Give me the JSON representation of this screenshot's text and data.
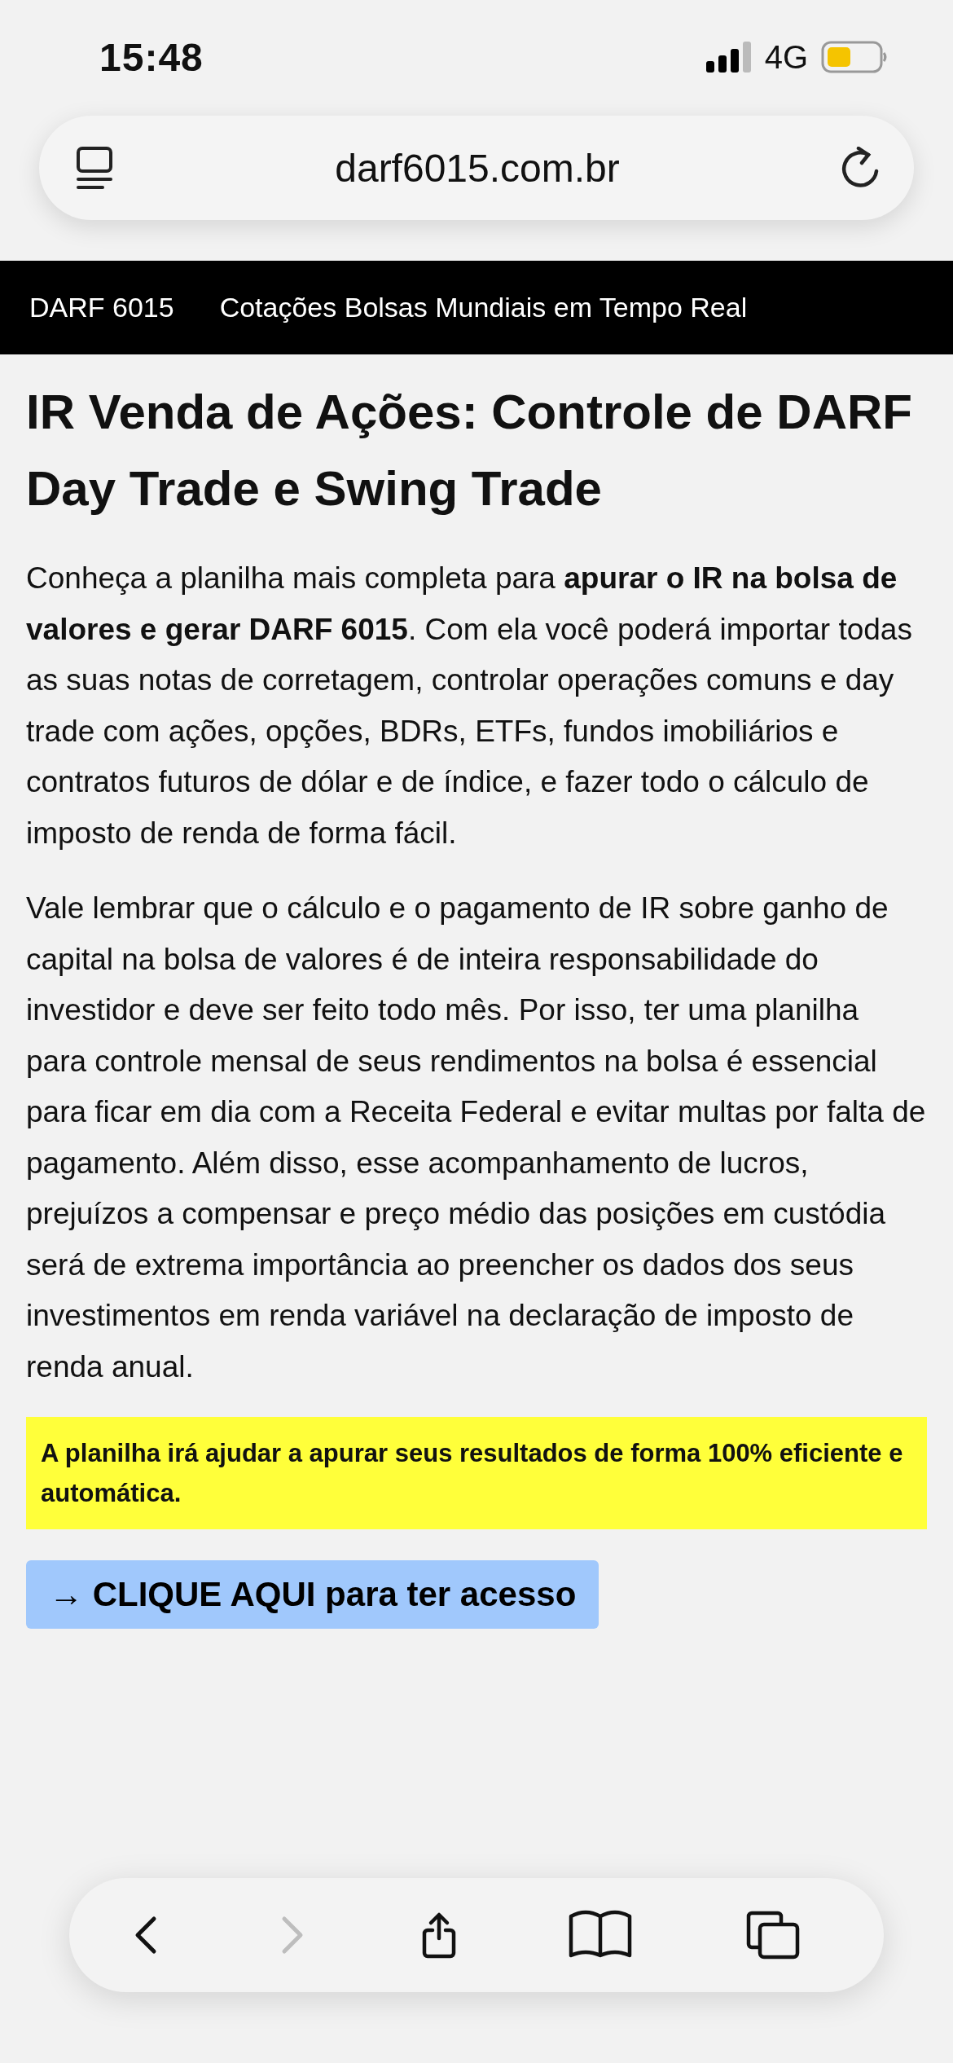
{
  "status_bar": {
    "time": "15:48",
    "network": "4G"
  },
  "address_bar": {
    "url": "darf6015.com.br"
  },
  "site_nav": {
    "items": [
      {
        "label": "DARF 6015"
      },
      {
        "label": "Cotações Bolsas Mundiais em Tempo Real"
      }
    ]
  },
  "article": {
    "title": "IR Venda de Ações: Controle de DARF Day Trade e Swing Trade",
    "paragraphs": [
      "Conheça a planilha mais completa para **apurar o IR na bolsa de valores e gerar DARF 6015**. Com ela você poderá importar todas as suas notas de corretagem, controlar operações comuns e day trade com ações, opções, BDRs, ETFs, fundos imobiliários e contratos futuros de dólar e de índice, e fazer todo o cálculo de imposto de renda de forma fácil.",
      "Vale lembrar que o cálculo e o pagamento de IR sobre ganho de capital na bolsa de valores é de inteira responsabilidade do investidor e deve ser feito todo mês. Por isso, ter uma planilha para controle mensal de seus rendimentos na bolsa é essencial para ficar em dia com a Receita Federal e evitar multas por falta de pagamento. Além disso, esse acompanhamento de lucros, prejuízos a compensar e preço médio das posições em custódia será de extrema importância ao preencher os dados dos seus investimentos em renda variável na declaração de imposto de renda anual."
    ],
    "highlight": "A planilha irá ajudar a apurar seus resultados de forma 100% eficiente e automática.",
    "cta": "→ CLIQUE AQUI para ter acesso"
  },
  "toolbar": {
    "buttons": [
      {
        "kind": "back",
        "disabled": false
      },
      {
        "kind": "forward",
        "disabled": true
      },
      {
        "kind": "share",
        "disabled": false
      },
      {
        "kind": "bookmarks",
        "disabled": false
      },
      {
        "kind": "tabs",
        "disabled": false
      }
    ]
  }
}
